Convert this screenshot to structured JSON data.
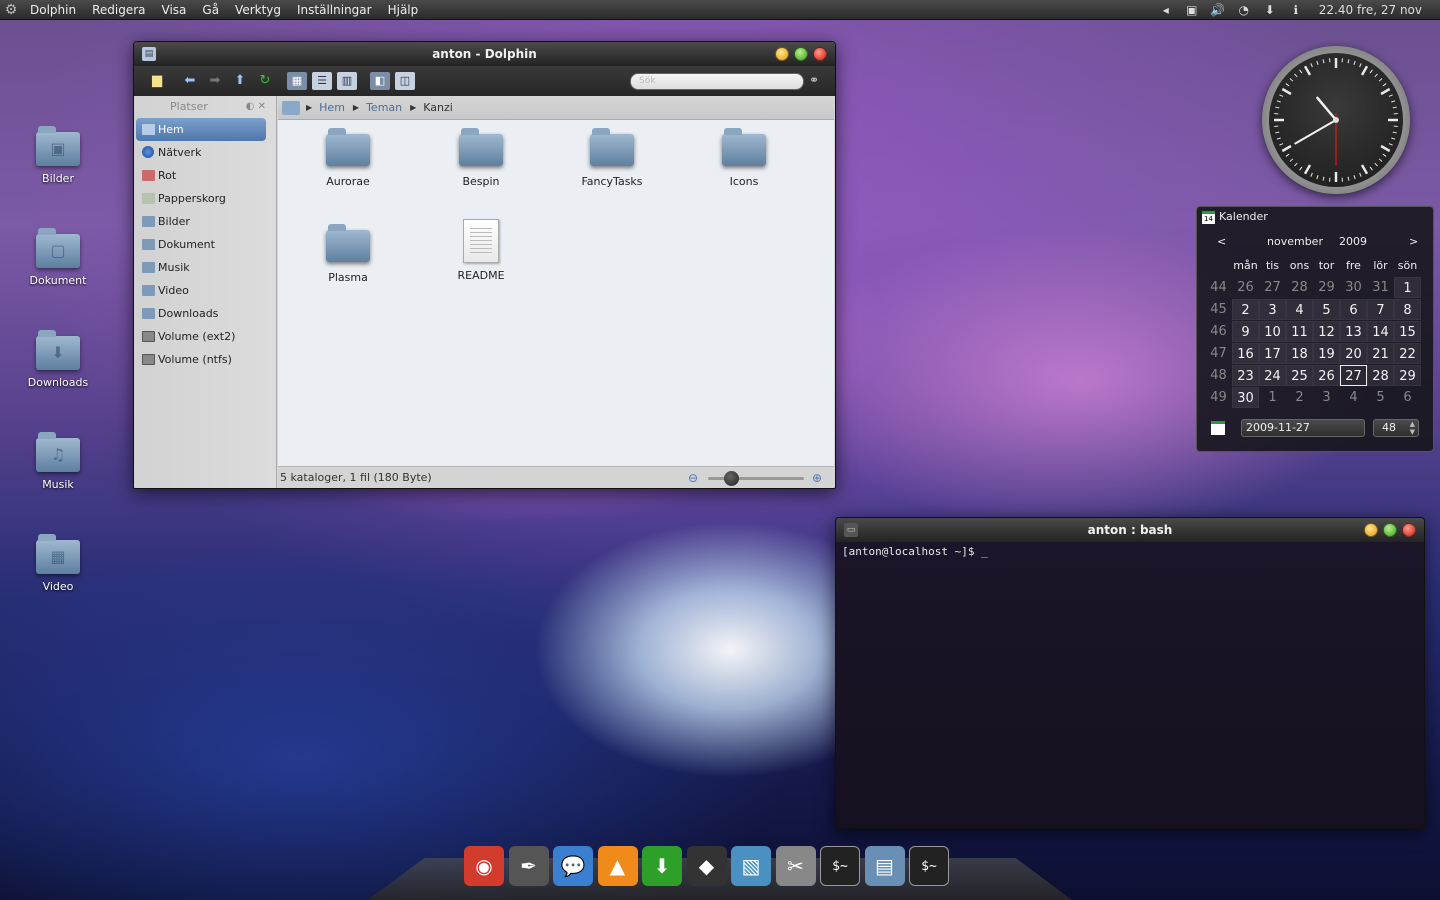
{
  "menubar": {
    "items": [
      "Dolphin",
      "Redigera",
      "Visa",
      "Gå",
      "Verktyg",
      "Inställningar",
      "Hjälp"
    ],
    "clock": "22.40  fre, 27 nov"
  },
  "desktop": {
    "icons": [
      {
        "label": "Bilder",
        "glyph": "▣"
      },
      {
        "label": "Dokument",
        "glyph": "▢"
      },
      {
        "label": "Downloads",
        "glyph": "⬇"
      },
      {
        "label": "Musik",
        "glyph": "♫"
      },
      {
        "label": "Video",
        "glyph": "▦"
      }
    ]
  },
  "dolphin": {
    "title": "anton - Dolphin",
    "search_placeholder": "Sök",
    "places_header": "Platser",
    "places": [
      "Hem",
      "Nätverk",
      "Rot",
      "Papperskorg",
      "Bilder",
      "Dokument",
      "Musik",
      "Video",
      "Downloads",
      "Volume (ext2)",
      "Volume (ntfs)"
    ],
    "selected_place": "Hem",
    "breadcrumb": [
      "Hem",
      "Teman",
      "Kanzi"
    ],
    "files": [
      {
        "name": "Aurorae",
        "type": "folder"
      },
      {
        "name": "Bespin",
        "type": "folder"
      },
      {
        "name": "FancyTasks",
        "type": "folder"
      },
      {
        "name": "Icons",
        "type": "folder"
      },
      {
        "name": "Plasma",
        "type": "folder"
      },
      {
        "name": "README",
        "type": "file"
      }
    ],
    "status": "5 kataloger, 1 fil (180 Byte)"
  },
  "terminal": {
    "title": "anton : bash",
    "prompt": "[anton@localhost ~]$ _"
  },
  "clock_widget": {
    "hour": 22,
    "minute": 40
  },
  "calendar": {
    "title": "Kalender",
    "month": "november",
    "year": "2009",
    "prev": "<",
    "next": ">",
    "weekdays": [
      "mån",
      "tis",
      "ons",
      "tor",
      "fre",
      "lör",
      "sön"
    ],
    "weeks": [
      {
        "num": "44",
        "days": [
          "26",
          "27",
          "28",
          "29",
          "30",
          "31",
          "1"
        ]
      },
      {
        "num": "45",
        "days": [
          "2",
          "3",
          "4",
          "5",
          "6",
          "7",
          "8"
        ]
      },
      {
        "num": "46",
        "days": [
          "9",
          "10",
          "11",
          "12",
          "13",
          "14",
          "15"
        ]
      },
      {
        "num": "47",
        "days": [
          "16",
          "17",
          "18",
          "19",
          "20",
          "21",
          "22"
        ]
      },
      {
        "num": "48",
        "days": [
          "23",
          "24",
          "25",
          "26",
          "27",
          "28",
          "29"
        ]
      },
      {
        "num": "49",
        "days": [
          "30",
          "1",
          "2",
          "3",
          "4",
          "5",
          "6"
        ]
      }
    ],
    "today": "27",
    "date_field": "2009-11-27",
    "week_field": "48"
  },
  "dock": {
    "items": [
      {
        "name": "chrome",
        "glyph": "◉",
        "color": "#d33b2c"
      },
      {
        "name": "inkscape-pen",
        "glyph": "✒",
        "color": "#555"
      },
      {
        "name": "chat",
        "glyph": "💬",
        "color": "#3a7fd0"
      },
      {
        "name": "vlc",
        "glyph": "▲",
        "color": "#f08a1a"
      },
      {
        "name": "download",
        "glyph": "⬇",
        "color": "#2ea02a"
      },
      {
        "name": "inkscape",
        "glyph": "◆",
        "color": "#333"
      },
      {
        "name": "image-viewer",
        "glyph": "▧",
        "color": "#4a90c0"
      },
      {
        "name": "tools",
        "glyph": "✂",
        "color": "#888"
      },
      {
        "name": "terminal-1",
        "glyph": "$~",
        "color": "#222"
      },
      {
        "name": "file-manager",
        "glyph": "▤",
        "color": "#6a8fb5"
      },
      {
        "name": "terminal-2",
        "glyph": "$~",
        "color": "#222"
      }
    ]
  }
}
